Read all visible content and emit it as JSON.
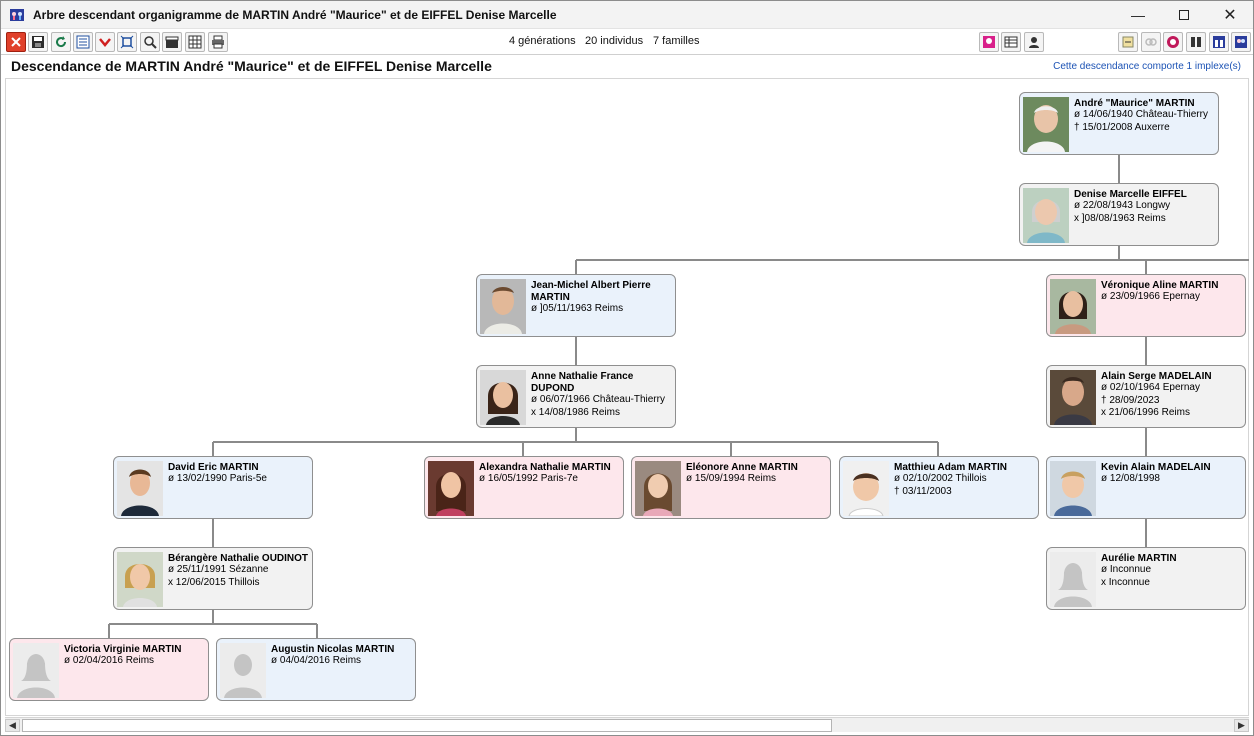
{
  "window": {
    "title": "Arbre descendant organigramme de MARTIN André \"Maurice\" et de EIFFEL Denise Marcelle"
  },
  "toolbar": {
    "stats": {
      "generations": "4 générations",
      "individuals": "20 individus",
      "families": "7 familles"
    }
  },
  "header": {
    "title": "Descendance de MARTIN André \"Maurice\" et de EIFFEL Denise Marcelle",
    "implexe_note": "Cette descendance comporte 1 implexe(s)"
  },
  "persons": {
    "andre": {
      "name": "André \"Maurice\"  MARTIN",
      "line1": "ø 14/06/1940  Château-Thierry",
      "line2": "† 15/01/2008  Auxerre"
    },
    "denise": {
      "name": "Denise Marcelle  EIFFEL",
      "line1": "ø 22/08/1943  Longwy",
      "line2": "x ]08/08/1963  Reims"
    },
    "jeanmichel": {
      "name": "Jean-Michel Albert Pierre MARTIN",
      "line1": "ø ]05/11/1963  Reims"
    },
    "anne": {
      "name": "Anne Nathalie France DUPOND",
      "line1": "ø 06/07/1966  Château-Thierry",
      "line2": "x 14/08/1986  Reims"
    },
    "veronique": {
      "name": "Véronique Aline  MARTIN",
      "line1": "ø 23/09/1966  Epernay"
    },
    "alain": {
      "name": "Alain Serge  MADELAIN",
      "line1": "ø 02/10/1964  Epernay",
      "line2": "† 28/09/2023",
      "line3": "x 21/06/1996  Reims"
    },
    "david": {
      "name": "David Eric  MARTIN",
      "line1": "ø 13/02/1990  Paris-5e"
    },
    "alexandra": {
      "name": "Alexandra Nathalie  MARTIN",
      "line1": "ø 16/05/1992  Paris-7e"
    },
    "eleonore": {
      "name": "Eléonore Anne  MARTIN",
      "line1": "ø 15/09/1994  Reims"
    },
    "matthieu": {
      "name": "Matthieu Adam  MARTIN",
      "line1": "ø 02/10/2002  Thillois",
      "line2": "† 03/11/2003"
    },
    "kevin": {
      "name": "Kevin Alain  MADELAIN",
      "line1": "ø 12/08/1998"
    },
    "berangere": {
      "name": "Bérangère Nathalie  OUDINOT",
      "line1": "ø 25/11/1991  Sézanne",
      "line2": "x 12/06/2015  Thillois"
    },
    "aurelie": {
      "name": "Aurélie  MARTIN",
      "line1": "ø Inconnue",
      "line2": "x Inconnue"
    },
    "victoria": {
      "name": "Victoria Virginie  MARTIN",
      "line1": "ø 02/04/2016  Reims"
    },
    "augustin": {
      "name": "Augustin Nicolas  MARTIN",
      "line1": "ø 04/04/2016  Reims"
    }
  },
  "colors": {
    "male_bg": "#eaf2fb",
    "female_bg": "#fde7ec",
    "spouse_bg": "#f2f2f2",
    "line": "#8a8a8a",
    "link": "#1c53b5"
  }
}
